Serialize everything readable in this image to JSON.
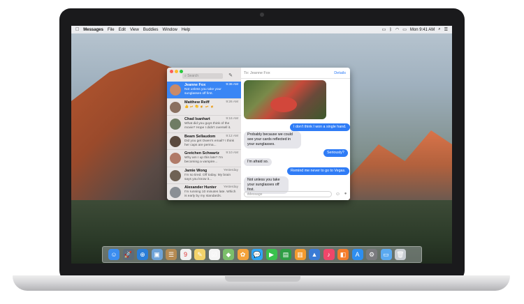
{
  "menubar": {
    "app": "Messages",
    "items": [
      "File",
      "Edit",
      "View",
      "Buddies",
      "Window",
      "Help"
    ],
    "clock": "Mon 9:41 AM"
  },
  "search": {
    "placeholder": "Search"
  },
  "conversations": [
    {
      "name": "Jeanne Fox",
      "time": "9:36 AM",
      "preview": "Not unless you take your sunglasses off first.",
      "selected": true
    },
    {
      "name": "Matthew Reiff",
      "time": "9:26 AM",
      "preview": "👍 🍻 👏 🍺 🍻 🍺"
    },
    {
      "name": "Chad Isanhart",
      "time": "9:16 AM",
      "preview": "What did you guys think of the movie? Hope I didn't oversell it."
    },
    {
      "name": "Beam Sellaudom",
      "time": "9:12 AM",
      "preview": "Did you get Owen's email? I think her caps are perma..."
    },
    {
      "name": "Gretchen Schwartz",
      "time": "9:10 AM",
      "preview": "Why am I up this late? I'm becoming a vampire..."
    },
    {
      "name": "Jamie Wong",
      "time": "Yesterday",
      "preview": "I'm so tired. Off today. My brain says you know it..."
    },
    {
      "name": "Alexander Hunter",
      "time": "Yesterday",
      "preview": "I'm running 10 minutes late. Which is early by my standards."
    }
  ],
  "chat": {
    "to_label": "To: Jeanne Fox",
    "details": "Details",
    "input_placeholder": "iMessage",
    "messages": [
      {
        "dir": "out",
        "text": "I don't think I won a single hand."
      },
      {
        "dir": "in",
        "text": "Probably because we could see your cards reflected in your sunglasses."
      },
      {
        "dir": "out",
        "text": "Seriously?"
      },
      {
        "dir": "in",
        "text": "I'm afraid so."
      },
      {
        "dir": "out",
        "text": "Remind me never to go to Vegas."
      },
      {
        "dir": "in",
        "text": "Not unless you take your sunglasses off first."
      }
    ]
  },
  "dock": {
    "items": [
      {
        "name": "finder-icon",
        "glyph": "☺",
        "color": "#3b8df0"
      },
      {
        "name": "launchpad-icon",
        "glyph": "🚀",
        "color": "#5c6b7a"
      },
      {
        "name": "safari-icon",
        "glyph": "⊕",
        "color": "#2b7ed8"
      },
      {
        "name": "photo-browser-icon",
        "glyph": "▣",
        "color": "#6fa3d8"
      },
      {
        "name": "contacts-icon",
        "glyph": "☰",
        "color": "#b58a52"
      },
      {
        "name": "calendar-icon",
        "glyph": "9",
        "color": "#f2f2f2"
      },
      {
        "name": "notes-icon",
        "glyph": "✎",
        "color": "#f3d36b"
      },
      {
        "name": "reminders-icon",
        "glyph": "☑",
        "color": "#f5f5f5"
      },
      {
        "name": "maps-icon",
        "glyph": "◆",
        "color": "#7bbf6a"
      },
      {
        "name": "photos-icon",
        "glyph": "✿",
        "color": "#f4a23b"
      },
      {
        "name": "messages-icon",
        "glyph": "💬",
        "color": "#2fa5f5"
      },
      {
        "name": "facetime-icon",
        "glyph": "▶",
        "color": "#3ac14d"
      },
      {
        "name": "numbers-icon",
        "glyph": "▤",
        "color": "#2f9e45"
      },
      {
        "name": "charts-icon",
        "glyph": "▥",
        "color": "#f39b2e"
      },
      {
        "name": "keynote-icon",
        "glyph": "▲",
        "color": "#3a7bd5"
      },
      {
        "name": "music-icon",
        "glyph": "♪",
        "color": "#f0466a"
      },
      {
        "name": "books-icon",
        "glyph": "◧",
        "color": "#f47c2a"
      },
      {
        "name": "app-store-icon",
        "glyph": "A",
        "color": "#2e8ef0"
      },
      {
        "name": "system-preferences-icon",
        "glyph": "⚙",
        "color": "#7a7a7e"
      },
      {
        "name": "downloads-folder-icon",
        "glyph": "▭",
        "color": "#5aa9f0"
      },
      {
        "name": "trash-icon",
        "glyph": "🗑",
        "color": "#c8cdd2"
      }
    ]
  },
  "colors": {
    "accent": "#2f7cf6",
    "selection": "#3a86f5",
    "bubble_in": "#e5e5ea"
  }
}
